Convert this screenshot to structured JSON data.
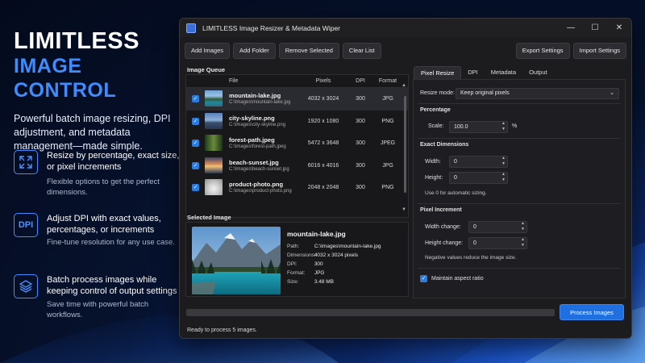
{
  "promo": {
    "title_line1": "LIMITLESS",
    "title_line2": "IMAGE CONTROL",
    "subtitle": "Powerful batch image resizing, DPI adjustment, and metadata management—made simple.",
    "features": [
      {
        "icon": "resize-arrows-icon",
        "icon_text": "",
        "title": "Resize by percentage, exact size, or pixel increments",
        "desc": "Flexible options to get the perfect dimensions."
      },
      {
        "icon": "dpi-icon",
        "icon_text": "DPI",
        "title": "Adjust DPI with exact values, percentages, or increments",
        "desc": "Fine-tune resolution for any use case."
      },
      {
        "icon": "layers-icon",
        "icon_text": "",
        "title": "Batch process images while keeping control of output settings",
        "desc": "Save time with powerful batch workflows."
      }
    ],
    "accent_color": "#3f8cff"
  },
  "window": {
    "title": "LIMITLESS Image Resizer & Metadata Wiper",
    "controls": {
      "minimize": "—",
      "maximize": "☐",
      "close": "✕"
    }
  },
  "toolbar": {
    "add_images": "Add Images",
    "add_folder": "Add Folder",
    "remove_selected": "Remove Selected",
    "clear_list": "Clear List",
    "export_settings": "Export Settings",
    "import_settings": "Import Settings"
  },
  "queue": {
    "label": "Image Queue",
    "headers": {
      "file": "File",
      "pixels": "Pixels",
      "dpi": "DPI",
      "format": "Format"
    },
    "rows": [
      {
        "name": "mountain-lake.jpg",
        "path": "C:\\Images\\mountain-lake.jpg",
        "pixels": "4032 x 3024",
        "dpi": "300",
        "format": "JPG",
        "checked": "✓"
      },
      {
        "name": "city-skyline.png",
        "path": "C:\\Images\\city-skyline.png",
        "pixels": "1920 x 1080",
        "dpi": "300",
        "format": "PNG",
        "checked": "✓"
      },
      {
        "name": "forest-path.jpeg",
        "path": "C:\\Images\\forest-path.jpeg",
        "pixels": "5472 x 3648",
        "dpi": "300",
        "format": "JPEG",
        "checked": "✓"
      },
      {
        "name": "beach-sunset.jpg",
        "path": "C:\\Images\\beach-sunset.jpg",
        "pixels": "6016 x 4016",
        "dpi": "300",
        "format": "JPG",
        "checked": "✓"
      },
      {
        "name": "product-photo.png",
        "path": "C:\\Images\\product-photo.png",
        "pixels": "2048 x 2048",
        "dpi": "300",
        "format": "PNG",
        "checked": "✓"
      }
    ]
  },
  "selected": {
    "label": "Selected Image",
    "name": "mountain-lake.jpg",
    "meta": [
      {
        "k": "Path:",
        "v": "C:\\Images\\mountain-lake.jpg"
      },
      {
        "k": "Dimensions:",
        "v": "4032 x 3024 pixels"
      },
      {
        "k": "DPI:",
        "v": "300"
      },
      {
        "k": "Format:",
        "v": "JPG"
      },
      {
        "k": "Size:",
        "v": "3.48 MB"
      }
    ]
  },
  "tabs": [
    "Pixel Resize",
    "DPI",
    "Metadata",
    "Output"
  ],
  "resize": {
    "mode_label": "Resize mode:",
    "mode_value": "Keep original pixels",
    "percentage_label": "Percentage",
    "scale_label": "Scale:",
    "scale_value": "100.0",
    "scale_unit": "%",
    "exact_label": "Exact Dimensions",
    "width_label": "Width:",
    "width_value": "0",
    "height_label": "Height:",
    "height_value": "0",
    "exact_note": "Use 0 for automatic sizing.",
    "increment_label": "Pixel Increment",
    "width_change_label": "Width change:",
    "width_change_value": "0",
    "height_change_label": "Height change:",
    "height_change_value": "0",
    "increment_note": "Negative values reduce the image size.",
    "aspect_label": "Maintain aspect ratio",
    "aspect_checked": "✓"
  },
  "footer": {
    "progress": 0,
    "process_button": "Process Images",
    "status": "Ready to process 5 images."
  }
}
